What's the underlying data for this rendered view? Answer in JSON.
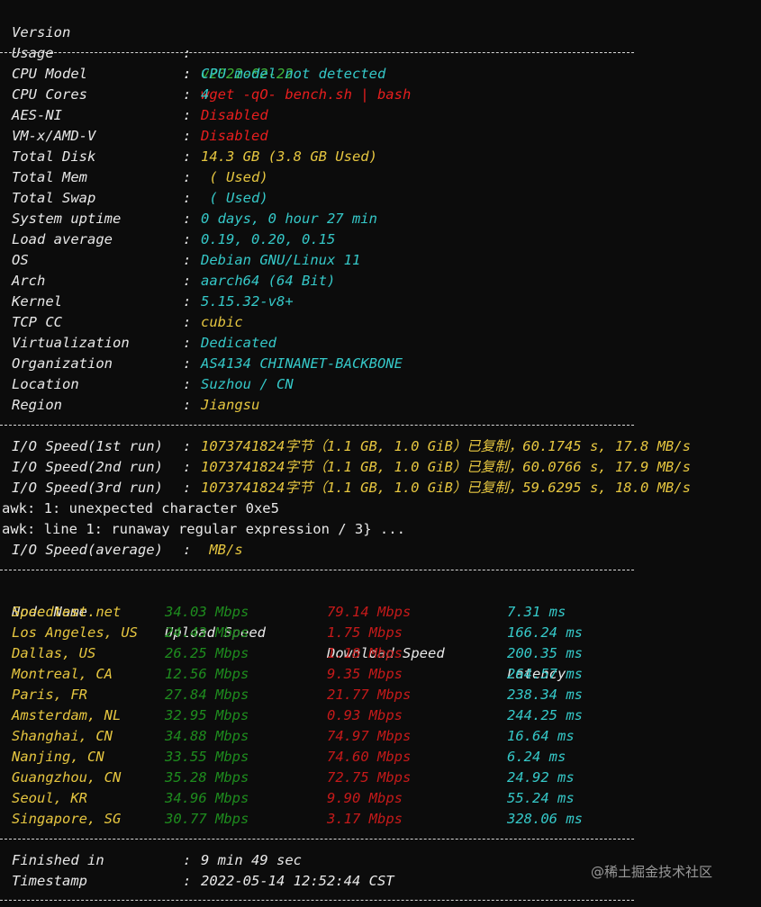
{
  "header": [
    {
      "label": "Version",
      "value": "v2022-02-22",
      "color": "green"
    },
    {
      "label": "Usage",
      "value": "wget -qO- bench.sh | bash",
      "color": "red"
    }
  ],
  "sysinfo": [
    {
      "label": "CPU Model",
      "value": "CPU model not detected",
      "color": "cyan"
    },
    {
      "label": "CPU Cores",
      "value": "4",
      "color": "cyan"
    },
    {
      "label": "AES-NI",
      "value": "Disabled",
      "color": "red"
    },
    {
      "label": "VM-x/AMD-V",
      "value": "Disabled",
      "color": "red"
    },
    {
      "label": "Total Disk",
      "value": "14.3 GB (3.8 GB Used)",
      "color": "yellow"
    },
    {
      "label": "Total Mem",
      "value": " ( Used)",
      "color": "yellow"
    },
    {
      "label": "Total Swap",
      "value": " ( Used)",
      "color": "cyan"
    },
    {
      "label": "System uptime",
      "value": "0 days, 0 hour 27 min",
      "color": "cyan"
    },
    {
      "label": "Load average",
      "value": "0.19, 0.20, 0.15",
      "color": "cyan"
    },
    {
      "label": "OS",
      "value": "Debian GNU/Linux 11",
      "color": "cyan"
    },
    {
      "label": "Arch",
      "value": "aarch64 (64 Bit)",
      "color": "cyan"
    },
    {
      "label": "Kernel",
      "value": "5.15.32-v8+",
      "color": "cyan"
    },
    {
      "label": "TCP CC",
      "value": "cubic",
      "color": "yellow"
    },
    {
      "label": "Virtualization",
      "value": "Dedicated",
      "color": "cyan"
    },
    {
      "label": "Organization",
      "value": "AS4134 CHINANET-BACKBONE",
      "color": "cyan"
    },
    {
      "label": "Location",
      "value": "Suzhou / CN",
      "color": "cyan"
    },
    {
      "label": "Region",
      "value": "Jiangsu",
      "color": "yellow"
    }
  ],
  "io": {
    "runs": [
      {
        "label": "I/O Speed(1st run)",
        "value": "1073741824字节（1.1 GB, 1.0 GiB）已复制，60.1745 s, 17.8 MB/s"
      },
      {
        "label": "I/O Speed(2nd run)",
        "value": "1073741824字节（1.1 GB, 1.0 GiB）已复制，60.0766 s, 17.9 MB/s"
      },
      {
        "label": "I/O Speed(3rd run)",
        "value": "1073741824字节（1.1 GB, 1.0 GiB）已复制，59.6295 s, 18.0 MB/s"
      }
    ],
    "awk_errors": [
      "awk: 1: unexpected character 0xe5",
      "awk: line 1: runaway regular expression / 3} ..."
    ],
    "average": {
      "label": "I/O Speed(average)",
      "value": " MB/s"
    }
  },
  "speedtest": {
    "headers": {
      "node": "Node Name",
      "upload": "Upload Speed",
      "download": "Download Speed",
      "latency": "Latency"
    },
    "rows": [
      {
        "node": "Speedtest.net",
        "upload": "34.03 Mbps",
        "download": "79.14 Mbps",
        "latency": "7.31 ms"
      },
      {
        "node": "Los Angeles, US",
        "upload": "24.43 Mbps",
        "download": "1.75 Mbps",
        "latency": "166.24 ms"
      },
      {
        "node": "Dallas, US",
        "upload": "26.25 Mbps",
        "download": "1.18 Mbps",
        "latency": "200.35 ms"
      },
      {
        "node": "Montreal, CA",
        "upload": "12.56 Mbps",
        "download": "9.35 Mbps",
        "latency": "264.57 ms"
      },
      {
        "node": "Paris, FR",
        "upload": "27.84 Mbps",
        "download": "21.77 Mbps",
        "latency": "238.34 ms"
      },
      {
        "node": "Amsterdam, NL",
        "upload": "32.95 Mbps",
        "download": "0.93 Mbps",
        "latency": "244.25 ms"
      },
      {
        "node": "Shanghai, CN",
        "upload": "34.88 Mbps",
        "download": "74.97 Mbps",
        "latency": "16.64 ms"
      },
      {
        "node": "Nanjing, CN",
        "upload": "33.55 Mbps",
        "download": "74.60 Mbps",
        "latency": "6.24 ms"
      },
      {
        "node": "Guangzhou, CN",
        "upload": "35.28 Mbps",
        "download": "72.75 Mbps",
        "latency": "24.92 ms"
      },
      {
        "node": "Seoul, KR",
        "upload": "34.96 Mbps",
        "download": "9.90 Mbps",
        "latency": "55.24 ms"
      },
      {
        "node": "Singapore, SG",
        "upload": "30.77 Mbps",
        "download": "3.17 Mbps",
        "latency": "328.06 ms"
      }
    ]
  },
  "footer": [
    {
      "label": "Finished in",
      "value": "9 min 49 sec"
    },
    {
      "label": "Timestamp",
      "value": "2022-05-14 12:52:44 CST"
    }
  ],
  "watermark": "@稀土掘金技术社区",
  "colors": {
    "background": "#0c0c0c",
    "green": "#3cb33c",
    "red": "#e81e1e",
    "cyan": "#35c8c8",
    "yellow": "#e6c640"
  }
}
